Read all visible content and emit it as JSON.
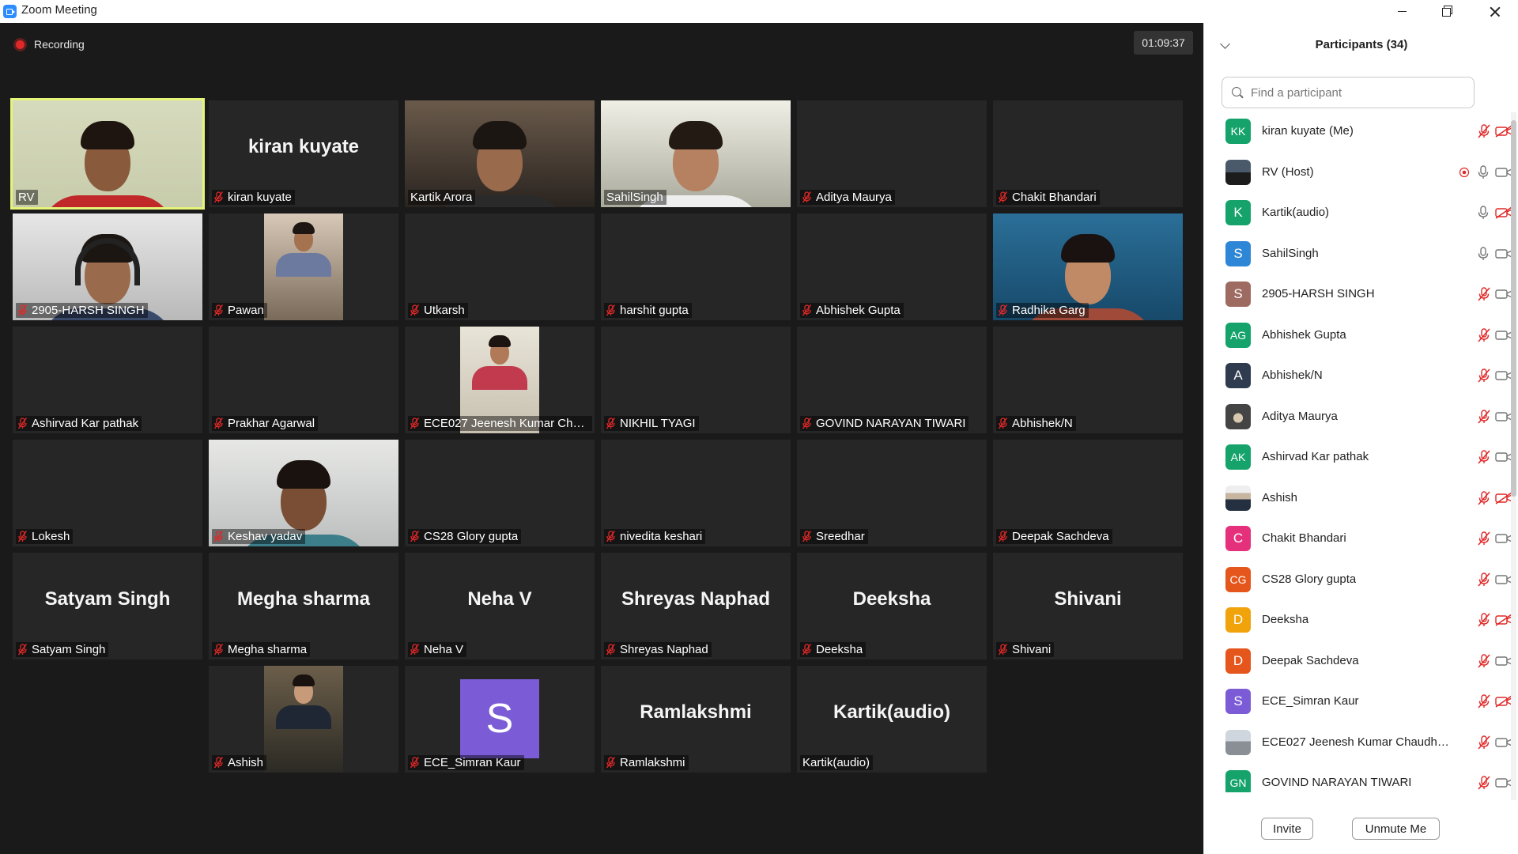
{
  "window": {
    "title": "Zoom Meeting"
  },
  "meeting": {
    "recording_label": "Recording",
    "elapsed_time": "01:09:37"
  },
  "tiles": [
    {
      "label": "RV",
      "muted": false,
      "video": "rv",
      "active": true
    },
    {
      "label": "kiran kuyate",
      "muted": true,
      "big_name": "kiran kuyate"
    },
    {
      "label": "Kartik Arora",
      "muted": false,
      "video": "kartik"
    },
    {
      "label": "SahilSingh",
      "muted": false,
      "video": "sahil"
    },
    {
      "label": "Aditya Maurya",
      "muted": true
    },
    {
      "label": "Chakit Bhandari",
      "muted": true
    },
    {
      "label": "2905-HARSH SINGH",
      "muted": true,
      "video": "harsh"
    },
    {
      "label": "Pawan",
      "muted": true,
      "video": "pawan"
    },
    {
      "label": "Utkarsh",
      "muted": true
    },
    {
      "label": "harshit gupta",
      "muted": true
    },
    {
      "label": "Abhishek Gupta",
      "muted": true
    },
    {
      "label": "Radhika Garg",
      "muted": true,
      "video": "radhika"
    },
    {
      "label": "Ashirvad Kar pathak",
      "muted": true
    },
    {
      "label": "Prakhar Agarwal",
      "muted": true
    },
    {
      "label": "ECE027 Jeenesh Kumar Cha...",
      "muted": true,
      "video": "jeenesh"
    },
    {
      "label": "NIKHIL TYAGI",
      "muted": true
    },
    {
      "label": "GOVIND NARAYAN TIWARI",
      "muted": true
    },
    {
      "label": "Abhishek/N",
      "muted": true
    },
    {
      "label": "Lokesh",
      "muted": true
    },
    {
      "label": "Keshav yadav",
      "muted": true,
      "video": "keshav"
    },
    {
      "label": "CS28 Glory gupta",
      "muted": true
    },
    {
      "label": "nivedita keshari",
      "muted": true
    },
    {
      "label": "Sreedhar",
      "muted": true
    },
    {
      "label": "Deepak Sachdeva",
      "muted": true
    },
    {
      "label": "Satyam Singh",
      "muted": true,
      "big_name": "Satyam Singh"
    },
    {
      "label": "Megha sharma",
      "muted": true,
      "big_name": "Megha sharma"
    },
    {
      "label": "Neha V",
      "muted": true,
      "big_name": "Neha V"
    },
    {
      "label": "Shreyas Naphad",
      "muted": true,
      "big_name": "Shreyas Naphad"
    },
    {
      "label": "Deeksha",
      "muted": true,
      "big_name": "Deeksha"
    },
    {
      "label": "Shivani",
      "muted": true,
      "big_name": "Shivani"
    },
    {
      "label": "Ashish",
      "muted": true,
      "video": "ashish"
    },
    {
      "label": "ECE_Simran Kaur",
      "muted": true,
      "avatar_letter": "S"
    },
    {
      "label": "Ramlakshmi",
      "muted": true,
      "big_name": "Ramlakshmi"
    },
    {
      "label": "Kartik(audio)",
      "muted": false,
      "big_name": "Kartik(audio)"
    }
  ],
  "participants_panel": {
    "title": "Participants (34)",
    "search_placeholder": "Find a participant",
    "invite_label": "Invite",
    "unmute_me_label": "Unmute Me",
    "participants": [
      {
        "name": "kiran kuyate (Me)",
        "initials": "KK",
        "color": "#15a36b",
        "mic": "off",
        "video": "off"
      },
      {
        "name": "RV (Host)",
        "photo": true,
        "mic": "on",
        "video": "on",
        "recording": true
      },
      {
        "name": "Kartik(audio)",
        "initials": "K",
        "color": "#15a36b",
        "mic": "on",
        "video": "off"
      },
      {
        "name": "SahilSingh",
        "initials": "S",
        "color": "#2d86d6",
        "mic": "on",
        "video": "on"
      },
      {
        "name": "2905-HARSH SINGH",
        "initials": "S",
        "color": "#9d6b61",
        "mic": "off",
        "video": "on"
      },
      {
        "name": "Abhishek Gupta",
        "initials": "AG",
        "color": "#15a36b",
        "mic": "off",
        "video": "on"
      },
      {
        "name": "Abhishek/N",
        "initials": "A",
        "color": "#2f3b4e",
        "mic": "off",
        "video": "on"
      },
      {
        "name": "Aditya Maurya",
        "photo": true,
        "mic": "off",
        "video": "on"
      },
      {
        "name": "Ashirvad Kar pathak",
        "initials": "AK",
        "color": "#15a36b",
        "mic": "off",
        "video": "on"
      },
      {
        "name": "Ashish",
        "photo": true,
        "mic": "off",
        "video": "off"
      },
      {
        "name": "Chakit Bhandari",
        "initials": "C",
        "color": "#e5307b",
        "mic": "off",
        "video": "on"
      },
      {
        "name": "CS28 Glory gupta",
        "initials": "CG",
        "color": "#e5561d",
        "mic": "off",
        "video": "on"
      },
      {
        "name": "Deeksha",
        "initials": "D",
        "color": "#f0a30a",
        "mic": "off",
        "video": "off"
      },
      {
        "name": "Deepak Sachdeva",
        "initials": "D",
        "color": "#e5561d",
        "mic": "off",
        "video": "on"
      },
      {
        "name": "ECE_Simran Kaur",
        "initials": "S",
        "color": "#7b5cd6",
        "mic": "off",
        "video": "off"
      },
      {
        "name": "ECE027 Jeenesh Kumar Chaudha...",
        "photo": true,
        "mic": "off",
        "video": "on"
      },
      {
        "name": "GOVIND NARAYAN TIWARI",
        "initials": "GN",
        "color": "#15a36b",
        "mic": "off",
        "video": "on"
      }
    ]
  }
}
